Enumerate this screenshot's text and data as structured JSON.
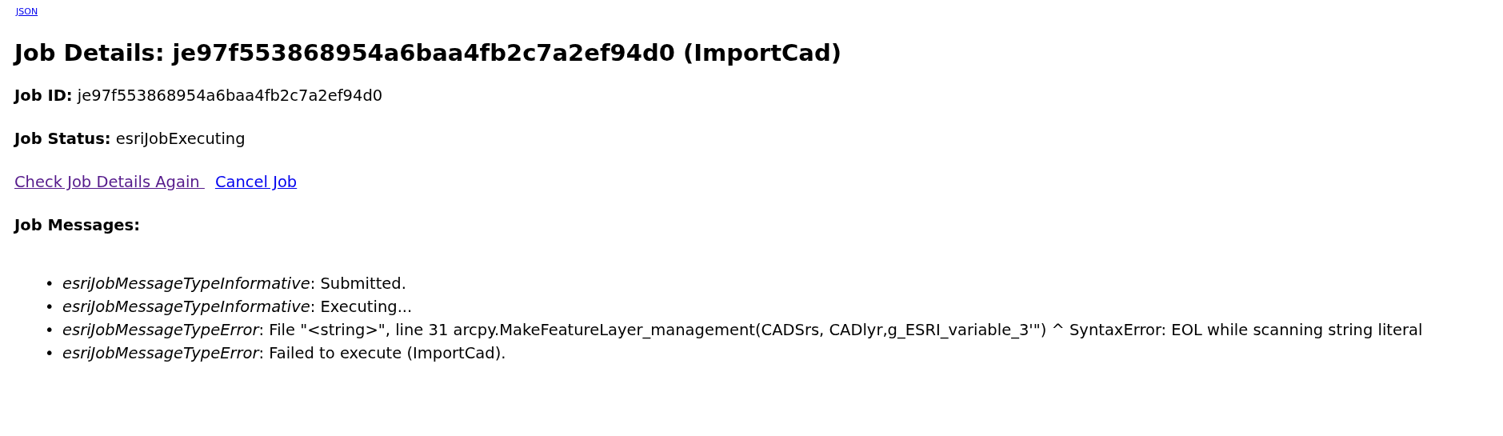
{
  "top_link": "JSON",
  "title": "Job Details: je97f553868954a6baa4fb2c7a2ef94d0 (ImportCad)",
  "fields": [
    {
      "label": "Job ID:",
      "value": "je97f553868954a6baa4fb2c7a2ef94d0"
    },
    {
      "label": "Job Status:",
      "value": "esriJobExecuting"
    }
  ],
  "actions": [
    {
      "label": "Check Job Details Again ",
      "visited": true
    },
    {
      "label": "Cancel Job",
      "visited": false
    }
  ],
  "messages_heading": "Job Messages:",
  "messages": [
    {
      "marker": "•",
      "text": "*esriJobMessageTypeInformative*: Submitted."
    },
    {
      "marker": "•",
      "text": "*esriJobMessageTypeInformative*: Executing..."
    },
    {
      "marker": "•",
      "text": "*esriJobMessageTypeError*: File \"<string>\", line 31 arcpy.MakeFeatureLayer_management(CADSrs, CADlyr,g_ESRI_variable_3'\") ^ SyntaxError: EOL while scanning string literal"
    },
    {
      "marker": "•",
      "text": "*esriJobMessageTypeError*: Failed to execute (ImportCad)."
    }
  ]
}
